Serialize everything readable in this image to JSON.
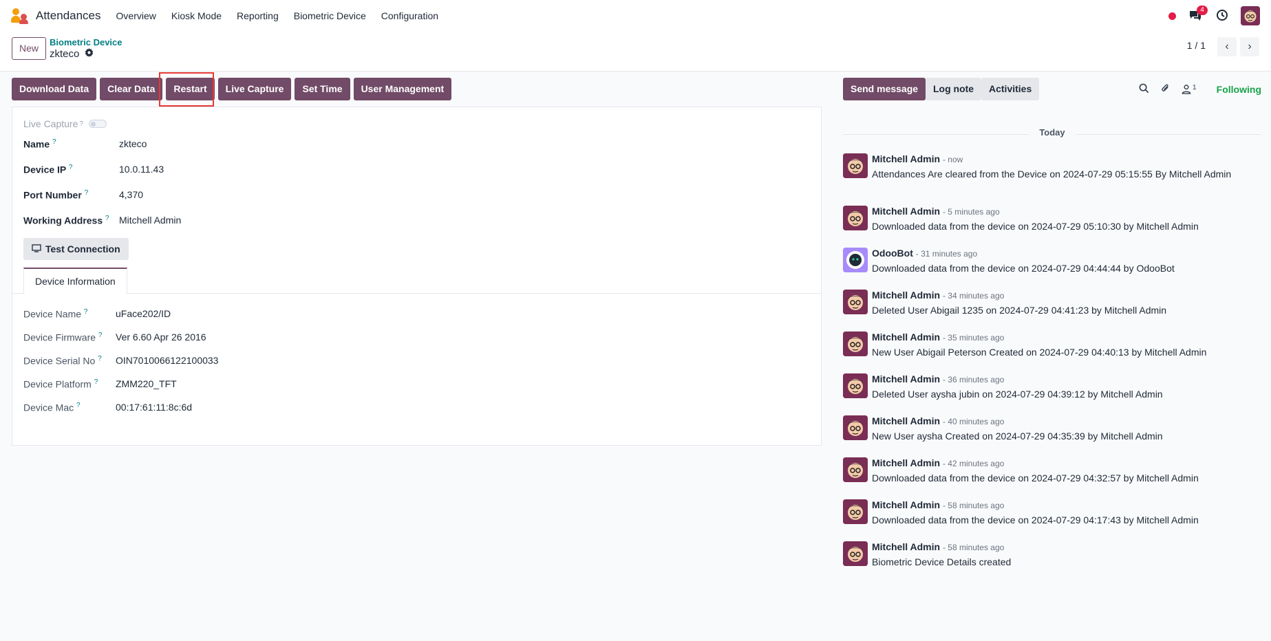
{
  "app": {
    "name": "Attendances"
  },
  "menu": [
    "Overview",
    "Kiosk Mode",
    "Reporting",
    "Biometric Device",
    "Configuration"
  ],
  "systray": {
    "chat_badge": "4"
  },
  "control_panel": {
    "new_label": "New",
    "breadcrumb_parent": "Biometric Device",
    "breadcrumb_current": "zkteco",
    "pager": "1 / 1"
  },
  "actions": {
    "download": "Download Data",
    "clear": "Clear Data",
    "restart": "Restart",
    "live_capture": "Live Capture",
    "set_time": "Set Time",
    "user_mgmt": "User Management"
  },
  "form": {
    "live_capture_label": "Live Capture",
    "name_label": "Name",
    "name_value": "zkteco",
    "ip_label": "Device IP",
    "ip_value": "10.0.11.43",
    "port_label": "Port Number",
    "port_value": "4,370",
    "address_label": "Working Address",
    "address_value": "Mitchell Admin",
    "test_connection": "Test Connection",
    "tab_device_info": "Device Information",
    "device_name_label": "Device Name",
    "device_name_value": "uFace202/ID",
    "firmware_label": "Device Firmware",
    "firmware_value": "Ver 6.60 Apr 26 2016",
    "serial_label": "Device Serial No",
    "serial_value": "OIN7010066122100033",
    "platform_label": "Device Platform",
    "platform_value": "ZMM220_TFT",
    "mac_label": "Device Mac",
    "mac_value": "00:17:61:11:8c:6d",
    "help_mark": "?"
  },
  "chatter": {
    "send_message": "Send message",
    "log_note": "Log note",
    "activities": "Activities",
    "follower_count": "1",
    "following": "Following",
    "today": "Today",
    "messages": [
      {
        "author": "Mitchell Admin",
        "time": "- now",
        "body": "Attendances Are cleared from the Device on 2024-07-29 05:15:55 By Mitchell Admin"
      },
      {
        "author": "Mitchell Admin",
        "time": "- 5 minutes ago",
        "body": "Downloaded data from the device on 2024-07-29 05:10:30 by Mitchell Admin"
      },
      {
        "author": "OdooBot",
        "time": "- 31 minutes ago",
        "body": "Downloaded data from the device on 2024-07-29 04:44:44 by OdooBot"
      },
      {
        "author": "Mitchell Admin",
        "time": "- 34 minutes ago",
        "body": "Deleted User Abigail 1235 on 2024-07-29 04:41:23 by Mitchell Admin"
      },
      {
        "author": "Mitchell Admin",
        "time": "- 35 minutes ago",
        "body": "New User Abigail Peterson Created on 2024-07-29 04:40:13 by Mitchell Admin"
      },
      {
        "author": "Mitchell Admin",
        "time": "- 36 minutes ago",
        "body": "Deleted User aysha jubin on 2024-07-29 04:39:12 by Mitchell Admin"
      },
      {
        "author": "Mitchell Admin",
        "time": "- 40 minutes ago",
        "body": "New User aysha Created on 2024-07-29 04:35:39 by Mitchell Admin"
      },
      {
        "author": "Mitchell Admin",
        "time": "- 42 minutes ago",
        "body": "Downloaded data from the device on 2024-07-29 04:32:57 by Mitchell Admin"
      },
      {
        "author": "Mitchell Admin",
        "time": "- 58 minutes ago",
        "body": "Downloaded data from the device on 2024-07-29 04:17:43 by Mitchell Admin"
      },
      {
        "author": "Mitchell Admin",
        "time": "- 58 minutes ago",
        "body": "Biometric Device Details created"
      }
    ]
  },
  "colors": {
    "primary": "#714b67",
    "teal": "#017e84",
    "highlight": "#e53935",
    "following": "#16a34a"
  }
}
